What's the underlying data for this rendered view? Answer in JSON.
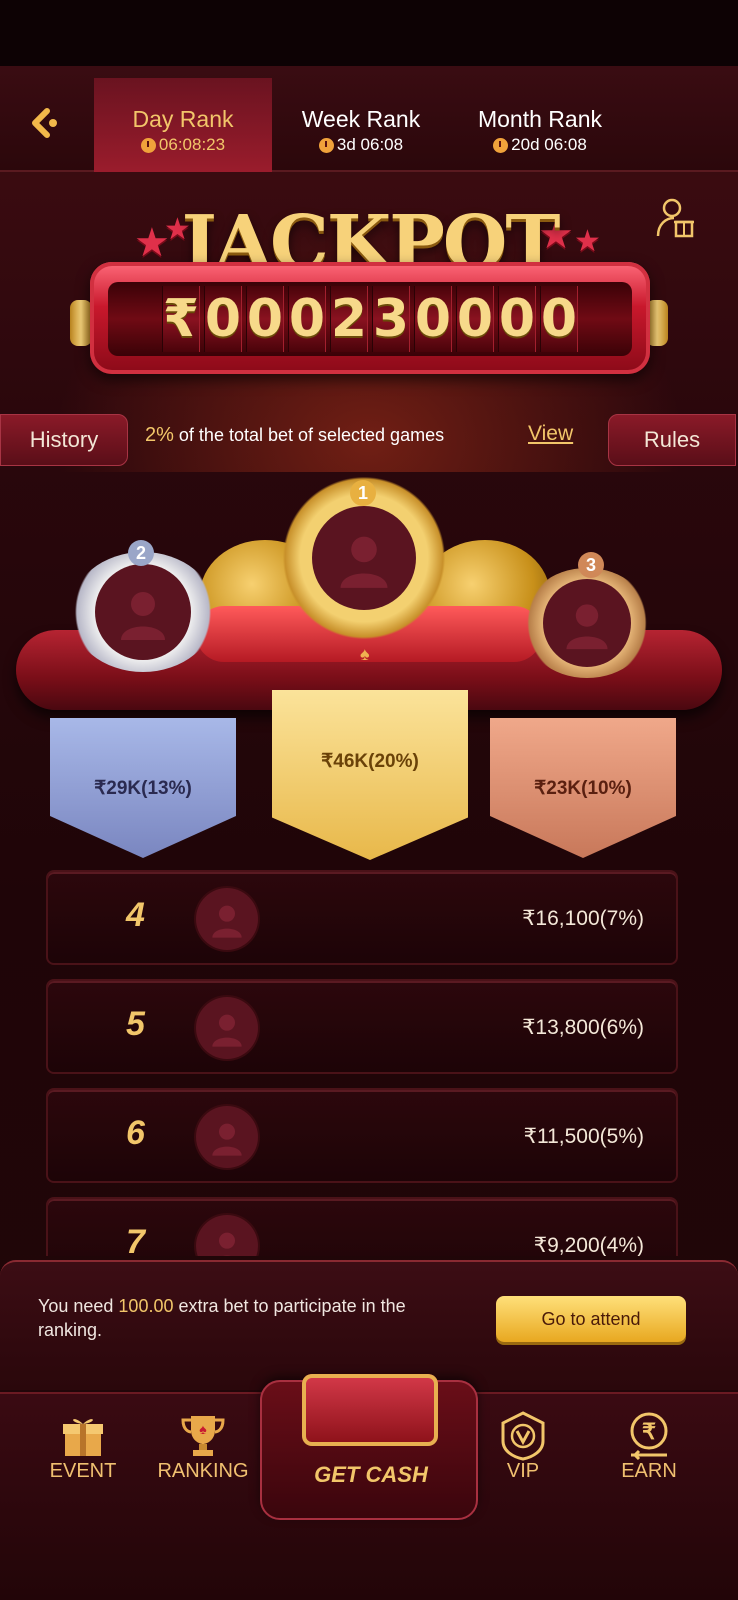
{
  "tabs": [
    {
      "label": "Day Rank",
      "time": "06:08:23",
      "active": true
    },
    {
      "label": "Week Rank",
      "time": "3d 06:08",
      "active": false
    },
    {
      "label": "Month Rank",
      "time": "20d 06:08",
      "active": false
    }
  ],
  "jackpot": {
    "title": "JACKPOT",
    "currency": "₹",
    "digits": [
      "0",
      "0",
      "0",
      "2",
      "3",
      "0",
      "0",
      "0",
      "0"
    ]
  },
  "info": {
    "history_label": "History",
    "rules_label": "Rules",
    "percent": "2%",
    "description": "of the total bet of selected games",
    "view_label": "View"
  },
  "podium": {
    "first": {
      "rank": "1",
      "prize": "₹46K(20%)"
    },
    "second": {
      "rank": "2",
      "prize": "₹29K(13%)"
    },
    "third": {
      "rank": "3",
      "prize": "₹23K(10%)"
    }
  },
  "ranking_rows": [
    {
      "rank": "4",
      "amount": "₹16,100(7%)"
    },
    {
      "rank": "5",
      "amount": "₹13,800(6%)"
    },
    {
      "rank": "6",
      "amount": "₹11,500(5%)"
    },
    {
      "rank": "7",
      "amount": "₹9,200(4%)"
    }
  ],
  "notice": {
    "prefix": "You need ",
    "amount": "100.00",
    "suffix": " extra bet to participate in the ranking.",
    "button_label": "Go to attend"
  },
  "tabbar": {
    "event": "EVENT",
    "ranking": "RANKING",
    "get_cash": "GET CASH",
    "vip": "VIP",
    "earn": "EARN"
  },
  "colors": {
    "gold": "#f2c66a",
    "crimson": "#9a1c2c",
    "background": "#2a070b"
  }
}
